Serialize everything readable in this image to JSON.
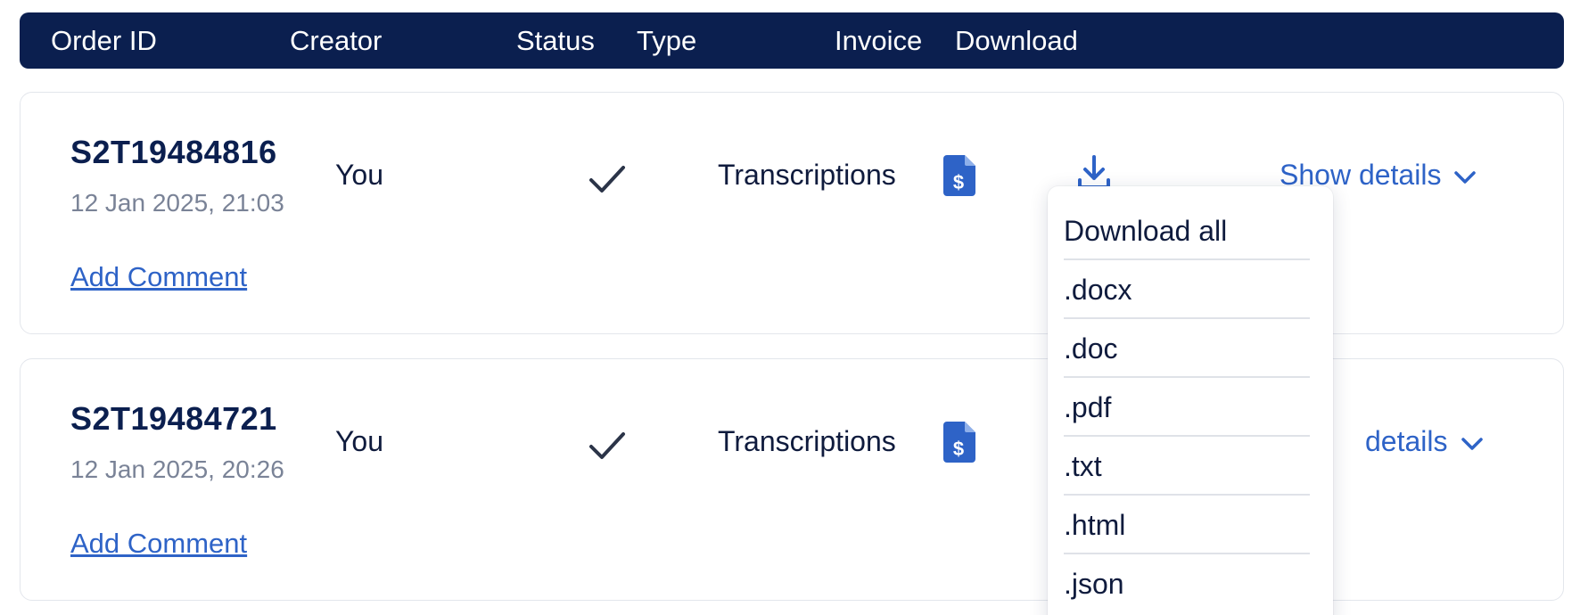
{
  "header": {
    "columns": [
      "Order ID",
      "Creator",
      "Status",
      "Type",
      "Invoice",
      "Download"
    ]
  },
  "orders": [
    {
      "order_id": "S2T19484816",
      "date": "12 Jan 2025, 21:03",
      "creator": "You",
      "status_icon": "check-icon",
      "type": "Transcriptions",
      "invoice_icon": "invoice-dollar-icon",
      "download_icon": "download-arrow-icon",
      "details_label": "Show details",
      "comment_label": "Add Comment"
    },
    {
      "order_id": "S2T19484721",
      "date": "12 Jan 2025, 20:26",
      "creator": "You",
      "status_icon": "check-icon",
      "type": "Transcriptions",
      "invoice_icon": "invoice-dollar-icon",
      "details_label": "details",
      "comment_label": "Add Comment"
    }
  ],
  "download_menu": {
    "items": [
      "Download all",
      ".docx",
      ".doc",
      ".pdf",
      ".txt",
      ".html",
      ".json"
    ]
  },
  "colors": {
    "header_bg": "#0b1f4f",
    "link": "#2e63c7",
    "icon_blue": "#2e63c7",
    "text_dark": "#0f1b3d",
    "text_muted": "#7a8397"
  }
}
